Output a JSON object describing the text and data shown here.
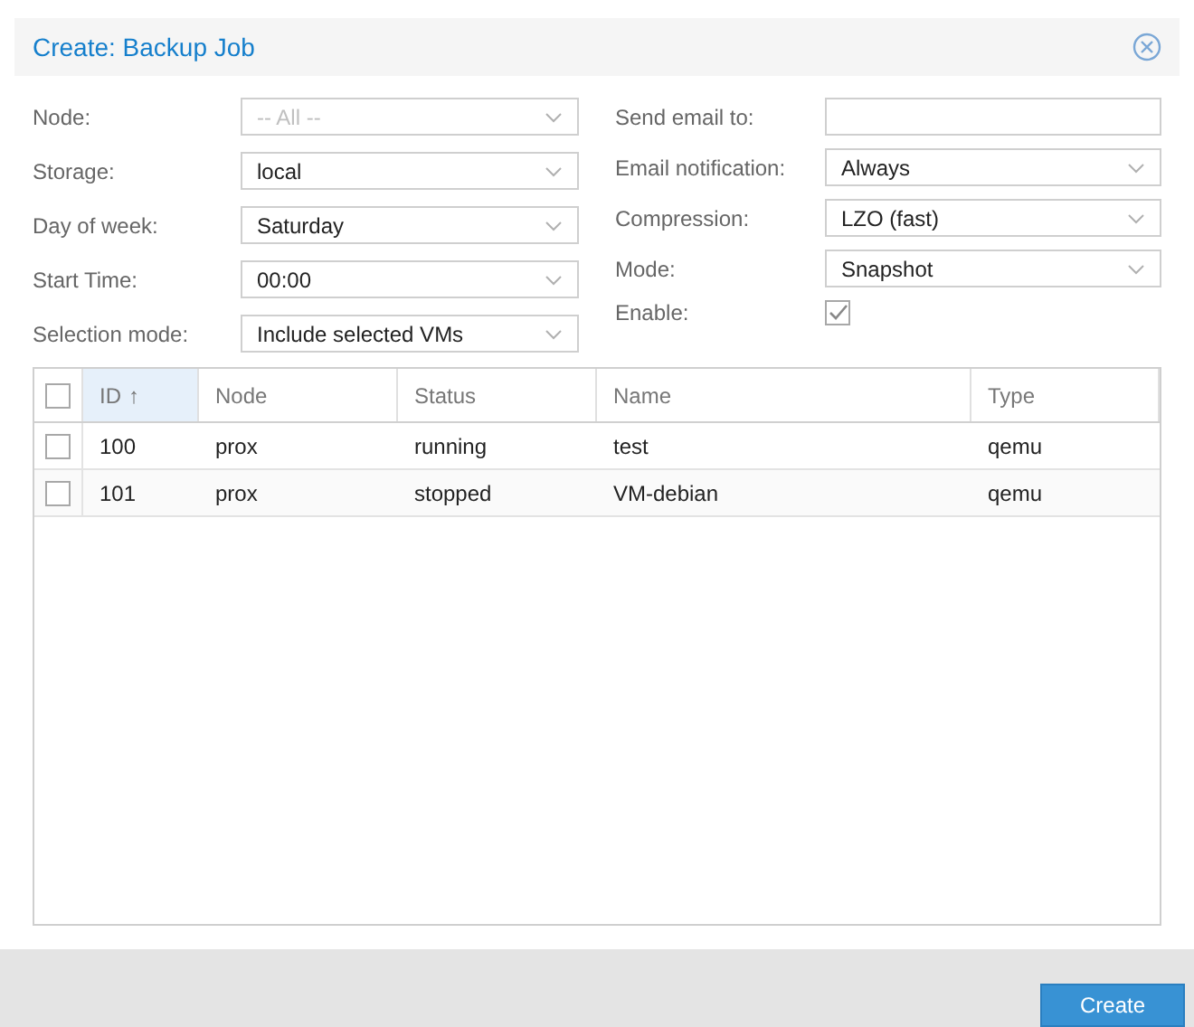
{
  "window": {
    "title": "Create: Backup Job"
  },
  "left_fields": [
    {
      "label": "Node:",
      "kind": "combo",
      "value": "-- All --",
      "disabled": true
    },
    {
      "label": "Storage:",
      "kind": "combo",
      "value": "local",
      "disabled": false
    },
    {
      "label": "Day of week:",
      "kind": "combo",
      "value": "Saturday",
      "disabled": false
    },
    {
      "label": "Start Time:",
      "kind": "combo",
      "value": "00:00",
      "disabled": false
    },
    {
      "label": "Selection mode:",
      "kind": "combo",
      "value": "Include selected VMs",
      "disabled": false
    }
  ],
  "right_fields": [
    {
      "label": "Send email to:",
      "kind": "text"
    },
    {
      "label": "Email notification:",
      "kind": "combo",
      "value": "Always"
    },
    {
      "label": "Compression:",
      "kind": "combo",
      "value": "LZO (fast)"
    },
    {
      "label": "Mode:",
      "kind": "combo",
      "value": "Snapshot"
    },
    {
      "label": "Enable:",
      "kind": "checkbox",
      "checked": true
    }
  ],
  "table": {
    "all_selected": false,
    "columns": [
      {
        "label": "ID",
        "sort": "↑",
        "sorted": true
      },
      {
        "label": "Node",
        "sorted": false
      },
      {
        "label": "Status",
        "sorted": false
      },
      {
        "label": "Name",
        "sorted": false
      },
      {
        "label": "Type",
        "sorted": false
      }
    ],
    "rows": [
      {
        "selected": false,
        "cells": [
          "100",
          "prox",
          "running",
          "test",
          "qemu"
        ]
      },
      {
        "selected": false,
        "cells": [
          "101",
          "prox",
          "stopped",
          "VM-debian",
          "qemu"
        ]
      }
    ]
  },
  "buttons": [
    {
      "label": "Create"
    }
  ]
}
